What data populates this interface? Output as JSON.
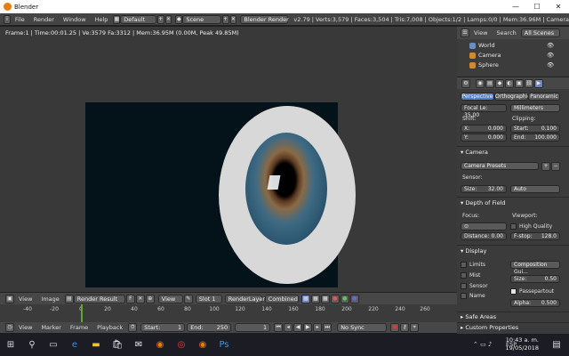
{
  "window": {
    "title": "Blender",
    "minimize": "—",
    "maximize": "☐",
    "close": "✕"
  },
  "infobar": {
    "menus": [
      "File",
      "Render",
      "Window",
      "Help"
    ],
    "screen": "Default",
    "scene": "Scene",
    "engine": "Blender Render",
    "stats": "v2.79 | Verts:3,579 | Faces:3,504 | Tris:7,008 | Objects:1/2 | Lamps:0/0 | Mem:36.96M | Camera"
  },
  "viewport": {
    "render_info": "Frame:1 | Time:00:01.25 | Ve:3579 Fa:3312 | Mem:36.95M (0.00M, Peak 49.85M)"
  },
  "image_header": {
    "view": "View",
    "image": "Image",
    "image_name": "Render Result",
    "f_btn": "F",
    "view2": "View",
    "slot": "Slot 1",
    "layer": "RenderLayer",
    "pass": "Combined"
  },
  "timeline": {
    "ticks": [
      "-40",
      "-20",
      "0",
      "20",
      "40",
      "60",
      "80",
      "100",
      "120",
      "140",
      "160",
      "180",
      "200",
      "220",
      "240",
      "260"
    ],
    "menus": [
      "View",
      "Marker",
      "Frame",
      "Playback"
    ],
    "start_label": "Start:",
    "start": "1",
    "end_label": "End:",
    "end": "250",
    "current": "1",
    "sync": "No Sync"
  },
  "outliner": {
    "view": "View",
    "search": "Search",
    "filter": "All Scenes",
    "items": [
      "World",
      "Camera",
      "Sphere"
    ]
  },
  "properties": {
    "tabs": [
      "Perspective",
      "Orthographic",
      "Panoramic"
    ],
    "focal_length": "Focal Le: 35.00",
    "lens_unit": "Millimeters",
    "shift_label": "Shift:",
    "shift_x_label": "X:",
    "shift_x": "0.000",
    "shift_y_label": "Y:",
    "shift_y": "0.000",
    "clipping_label": "Clipping:",
    "clip_start_label": "Start:",
    "clip_start": "0.100",
    "clip_end_label": "End:",
    "clip_end": "100.000",
    "camera_section": "Camera",
    "camera_presets": "Camera Presets",
    "sensor_label": "Sensor:",
    "size_label": "Size:",
    "size": "32.00",
    "sensor_fit": "Auto",
    "dof_section": "Depth of Field",
    "focus_label": "Focus:",
    "viewport_label": "Viewport:",
    "high_quality": "High Quality",
    "distance_label": "Distance:",
    "distance": "0.00",
    "fstop_label": "F-stop:",
    "fstop": "128.0",
    "display_section": "Display",
    "limits": "Limits",
    "mist": "Mist",
    "sensor_chk": "Sensor",
    "name_chk": "Name",
    "composition": "Composition Gui...",
    "disp_size_label": "Size:",
    "disp_size": "0.50",
    "passepartout": "Passepartout",
    "alpha_label": "Alpha:",
    "alpha": "0.500",
    "safe_areas": "Safe Areas",
    "custom_props": "Custom Properties"
  },
  "taskbar": {
    "time": "10:43 a. m.",
    "date": "19/05/2018",
    "lang": "ESP"
  }
}
